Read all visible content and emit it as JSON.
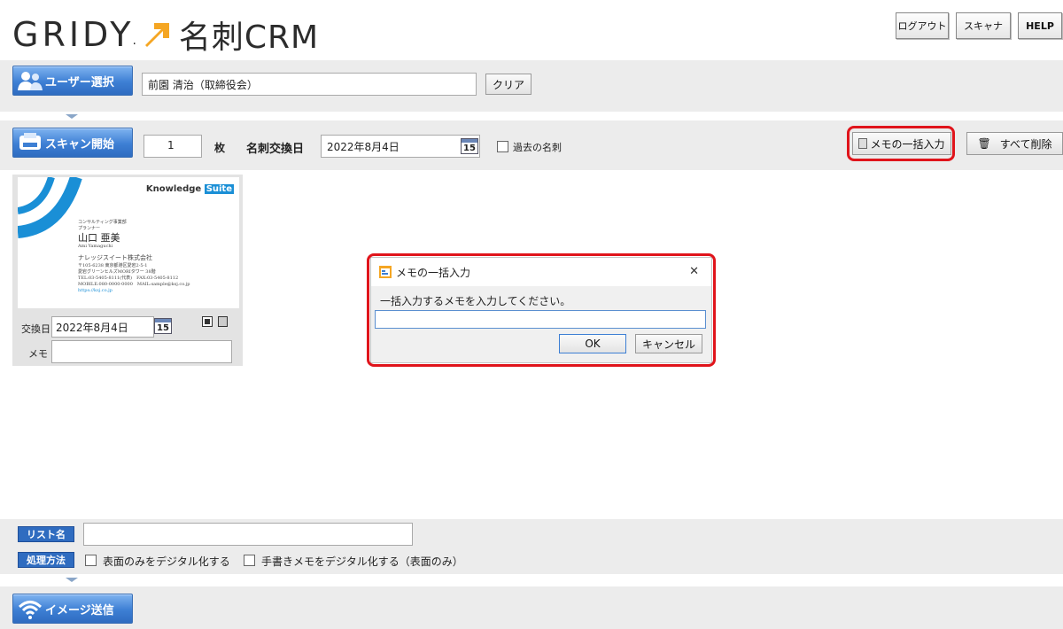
{
  "header": {
    "logo_text": "GRIDY",
    "logo_dot": ".",
    "logo_sub": "名刺CRM",
    "buttons": {
      "logout": "ログアウト",
      "scanner": "スキャナ",
      "help": "HELP"
    }
  },
  "user_bar": {
    "select_label": "ユーザー選択",
    "user_value": "前園 清治（取締役会）",
    "clear_label": "クリア"
  },
  "scan_bar": {
    "start_label": "スキャン開始",
    "count_value": "1",
    "count_unit": "枚",
    "date_label": "名刺交換日",
    "date_value": "2022年8月4日",
    "calendar_day": "15",
    "past_label": "過去の名刺",
    "memo_bulk_label": "メモの一括入力",
    "delete_all_label": "すべて削除"
  },
  "card": {
    "brand": "Knowledge",
    "brand_box": "Suite",
    "dept": "コンサルティング事業部",
    "title": "プランナー",
    "name": "山口 亜美",
    "name_roman": "Ami Yamaguchi",
    "company": "ナレッジスイート株式会社",
    "address1": "〒105-6238 東京都港区愛宕2-5-1",
    "address2": "愛宕グリーンヒルズMORIタワー 38階",
    "tel": "TEL:03-5405-8111(代表)　FAX:03-5405-8112",
    "mobile": "MOBILE:080-0000-0000　MAIL:sample@ksj.co.jp",
    "url": "https://ksj.co.jp",
    "exchange_label": "交換日",
    "exchange_value": "2022年8月4日",
    "calendar_day": "15",
    "memo_label": "メモ",
    "memo_value": ""
  },
  "dialog": {
    "title": "メモの一括入力",
    "close": "✕",
    "message": "一括入力するメモを入力してください。",
    "input_value": "",
    "ok_label": "OK",
    "cancel_label": "キャンセル"
  },
  "bottom": {
    "list_name_label": "リスト名",
    "list_name_value": "",
    "method_label": "処理方法",
    "option1": "表面のみをデジタル化する",
    "option2": "手書きメモをデジタル化する（表面のみ）",
    "send_label": "イメージ送信"
  },
  "colors": {
    "accent_blue": "#3d7fd4",
    "highlight_red": "#e0141b",
    "logo_orange": "#f5a623"
  }
}
